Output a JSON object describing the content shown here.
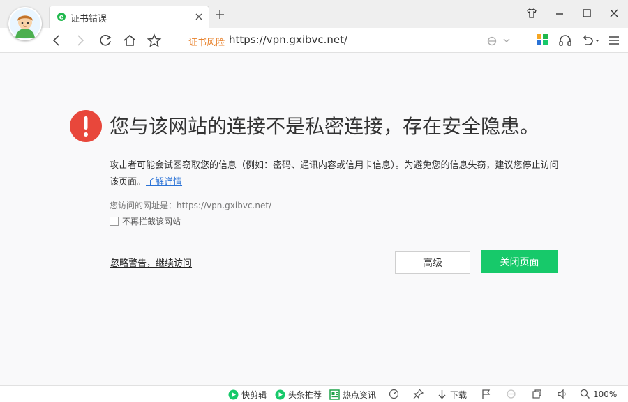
{
  "tab": {
    "title": "证书错误"
  },
  "address": {
    "cert_warning": "证书风险",
    "url": "https://vpn.gxibvc.net/"
  },
  "page": {
    "headline": "您与该网站的连接不是私密连接，存在安全隐患。",
    "description": "攻击者可能会试图窃取您的信息（例如：密码、通讯内容或信用卡信息）。为避免您的信息失窃，建议您停止访问该页面。",
    "learn_more": "了解详情",
    "visited_label": "您访问的网址是：",
    "visited_url": "https://vpn.gxibvc.net/",
    "no_intercept": "不再拦截该网站",
    "ignore_link": "忽略警告，继续访问",
    "advanced_button": "高级",
    "close_button": "关闭页面"
  },
  "statusbar": {
    "quick_clip": "快剪辑",
    "headlines": "头条推荐",
    "hot_news": "热点资讯",
    "download": "下载",
    "zoom": "100%"
  },
  "colors": {
    "accent_green": "#17c96a",
    "warning_red": "#e8473b",
    "cert_orange": "#e8832e",
    "link_blue": "#2a72d6"
  },
  "icons": [
    "user-avatar-icon",
    "ie-logo-icon",
    "close-icon",
    "plus-icon",
    "skin-icon",
    "minimize-icon",
    "maximize-icon",
    "back-icon",
    "forward-icon",
    "refresh-icon",
    "home-icon",
    "star-icon",
    "compat-mode-icon",
    "chevron-down-icon",
    "apps-icon",
    "headset-icon",
    "undo-icon",
    "menu-icon",
    "warning-icon",
    "play-icon",
    "news-icon",
    "speedup-icon",
    "pin-icon",
    "download-icon",
    "flag-icon",
    "ie-icon",
    "window-icon",
    "speaker-icon",
    "search-icon"
  ]
}
